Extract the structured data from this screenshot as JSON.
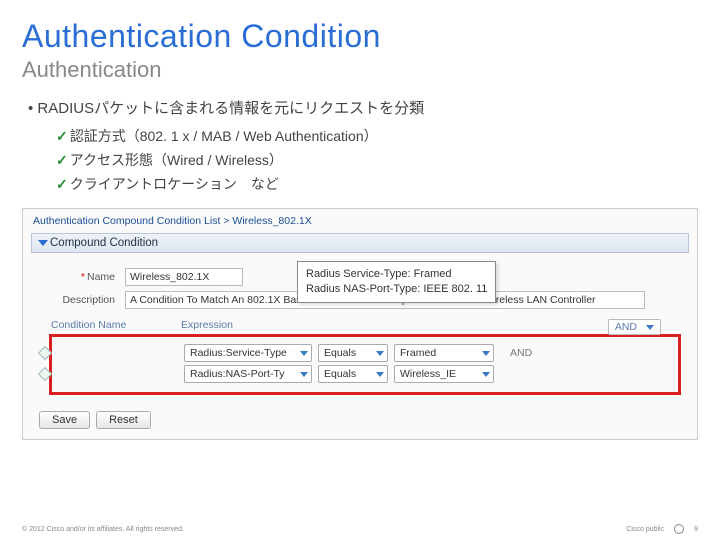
{
  "title": "Authentication Condition",
  "subtitle": "Authentication",
  "bullet1": "RADIUSパケットに含まれる情報を元にリクエストを分類",
  "sub1": "認証方式（802. 1 x / MAB / Web Authentication）",
  "sub2": "アクセス形態（Wired / Wireless）",
  "sub3": "クライアントロケーション　など",
  "breadcrumb": "Authentication Compound Condition List > Wireless_802.1X",
  "section": "Compound Condition",
  "nameLabel": "Name",
  "nameValue": "Wireless_802.1X",
  "descLabel": "Description",
  "descValue": "A Condition To Match An 802.1X Based Authentication Request From Cisco Wireless LAN Controller",
  "condHeader1": "Condition Name",
  "condHeader2": "Expression",
  "andPill": "AND",
  "rows": [
    {
      "attr": "Radius:Service-Type",
      "op": "Equals",
      "val": "Framed",
      "tail": "AND"
    },
    {
      "attr": "Radius:NAS-Port-Ty",
      "op": "Equals",
      "val": "Wireless_IE",
      "tail": ""
    }
  ],
  "callout1": "Radius Service-Type: Framed",
  "callout2": "Radius NAS-Port-Type: IEEE 802. 11",
  "save": "Save",
  "reset": "Reset",
  "copyright": "© 2012 Cisco and/or its affiliates. All rights reserved.",
  "brand": "Cisco public",
  "page": "9"
}
